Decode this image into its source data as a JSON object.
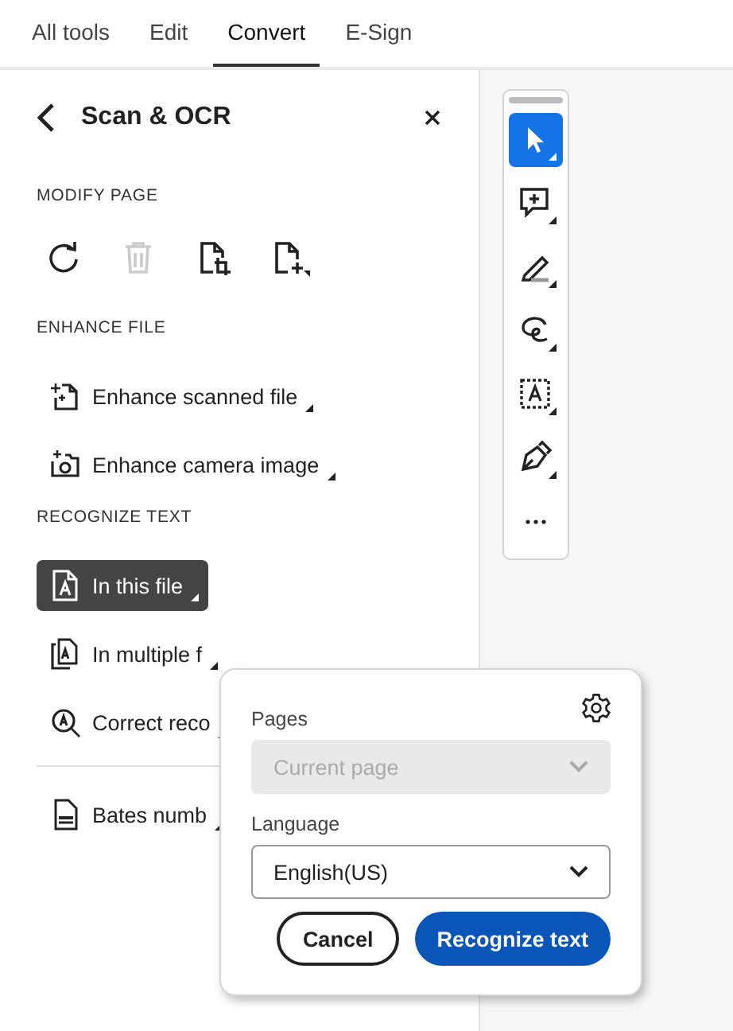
{
  "tabs": [
    {
      "label": "All tools",
      "selected": false
    },
    {
      "label": "Edit",
      "selected": false
    },
    {
      "label": "Convert",
      "selected": true
    },
    {
      "label": "E-Sign",
      "selected": false
    }
  ],
  "panel": {
    "title": "Scan & OCR",
    "sections": [
      {
        "heading": "MODIFY PAGE",
        "kind": "icons",
        "items": [
          {
            "kind": "rotate",
            "disabled": false
          },
          {
            "kind": "delete",
            "disabled": true
          },
          {
            "kind": "crop",
            "disabled": false
          },
          {
            "kind": "insert",
            "disabled": false
          }
        ]
      },
      {
        "heading": "ENHANCE FILE",
        "kind": "list",
        "items": [
          {
            "label": "Enhance scanned file",
            "kind": "scan",
            "selected": false
          },
          {
            "label": "Enhance camera image",
            "kind": "camera",
            "selected": false
          }
        ]
      },
      {
        "heading": "RECOGNIZE TEXT",
        "kind": "list",
        "items": [
          {
            "label": "In this file",
            "kind": "page-text",
            "selected": true
          },
          {
            "label": "In multiple f",
            "kind": "pages-text",
            "selected": false
          },
          {
            "label": "Correct reco",
            "kind": "magnify",
            "selected": false
          }
        ]
      },
      {
        "kind": "list",
        "divider": true,
        "items": [
          {
            "label": "Bates numb",
            "kind": "bates",
            "selected": false
          }
        ]
      }
    ]
  },
  "toolbar": [
    {
      "kind": "select",
      "selected": true
    },
    {
      "kind": "comment",
      "selected": false
    },
    {
      "kind": "highlight",
      "selected": false
    },
    {
      "kind": "draw",
      "selected": false
    },
    {
      "kind": "text-select",
      "selected": false
    },
    {
      "kind": "sign",
      "selected": false
    },
    {
      "kind": "more",
      "selected": false
    }
  ],
  "popover": {
    "pages": {
      "label": "Pages",
      "value": "Current page",
      "disabled": true
    },
    "language": {
      "label": "Language",
      "value": "English(US)",
      "disabled": false
    },
    "buttons": [
      {
        "label": "Cancel",
        "kind": "secondary"
      },
      {
        "label": "Recognize text",
        "kind": "primary"
      }
    ]
  }
}
